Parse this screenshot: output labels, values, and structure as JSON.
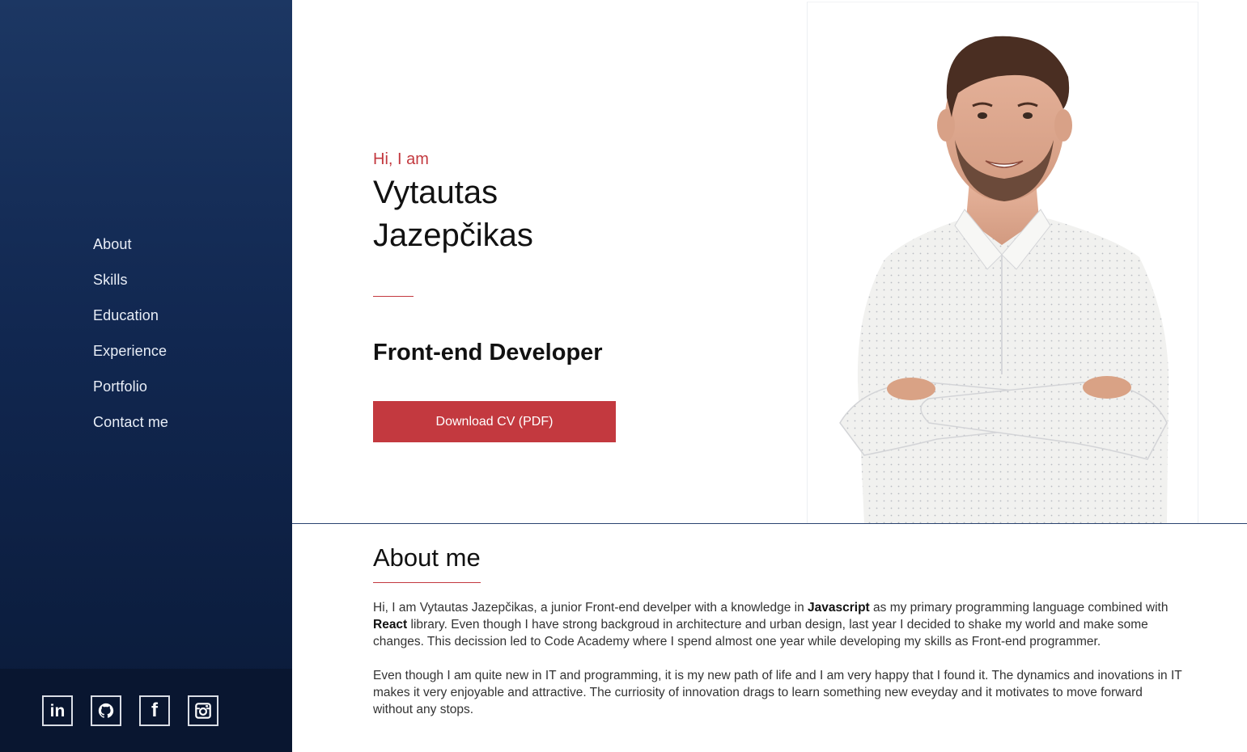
{
  "nav": {
    "items": [
      "About",
      "Skills",
      "Education",
      "Experience",
      "Portfolio",
      "Contact me"
    ]
  },
  "social": [
    {
      "icon": "linkedin-icon",
      "glyph": "in"
    },
    {
      "icon": "github-icon",
      "glyph": ""
    },
    {
      "icon": "facebook-icon",
      "glyph": "f"
    },
    {
      "icon": "instagram-icon",
      "glyph": ""
    }
  ],
  "hero": {
    "greeting": "Hi, I am",
    "first_name": "Vytautas",
    "last_name": "Jazepčikas",
    "role": "Front-end Developer",
    "cv_button": "Download CV (PDF)"
  },
  "about": {
    "title": "About me",
    "p1_a": "Hi, I am Vytautas Jazepčikas, a junior Front-end develper with a knowledge in ",
    "p1_b": "Javascript",
    "p1_c": " as my primary programming language combined with ",
    "p1_d": "React",
    "p1_e": " library. Even though I have strong backgroud in architecture and urban design, last year I decided to shake my world and make some changes. This decission led to Code Academy where I spend almost one year while developing my skills as Front-end programmer.",
    "p2": "Even though I am quite new in IT and programming, it is my new path of life and I am very happy that I found it. The dynamics and inovations in IT makes it very enjoyable and attractive. The curriosity of innovation drags to learn something new eveyday and it motivates to move forward without any stops."
  },
  "colors": {
    "sidebar_top": "#1c3763",
    "sidebar_bottom": "#0a1a38",
    "accent": "#c3393f"
  }
}
